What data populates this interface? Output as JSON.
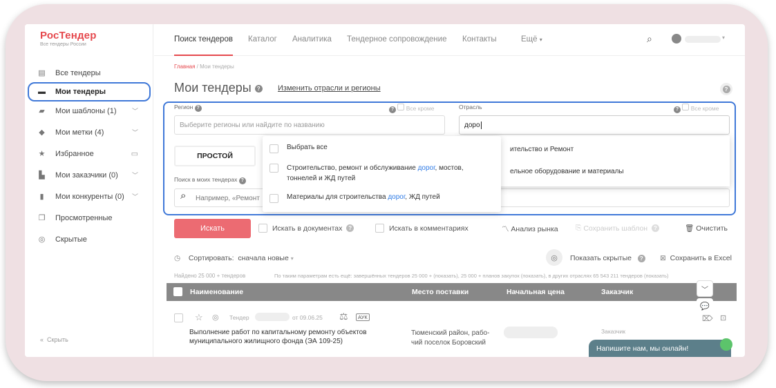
{
  "logo": {
    "title": "РосТендер",
    "subtitle": "Все тендеры России"
  },
  "sidebar": {
    "items": [
      {
        "label": "Все тендеры",
        "icon": "database-icon"
      },
      {
        "label": "Мои тендеры",
        "icon": "archive-icon"
      },
      {
        "label": "Мои шаблоны (1)",
        "icon": "folder-icon"
      },
      {
        "label": "Мои метки (4)",
        "icon": "tag-icon"
      },
      {
        "label": "Избранное",
        "icon": "star-icon"
      },
      {
        "label": "Мои заказчики (0)",
        "icon": "building-icon"
      },
      {
        "label": "Мои конкуренты (0)",
        "icon": "truck-icon"
      },
      {
        "label": "Просмотренные",
        "icon": "copy-icon"
      },
      {
        "label": "Скрытые",
        "icon": "eye-off-icon"
      }
    ],
    "collapse": "Скрыть"
  },
  "nav": {
    "tabs": [
      "Поиск тендеров",
      "Каталог",
      "Аналитика",
      "Тендерное сопровождение",
      "Контакты",
      "Ещё"
    ]
  },
  "breadcrumb": {
    "home": "Главная",
    "current": "Мои тендеры"
  },
  "page": {
    "title": "Мои тендеры",
    "link": "Изменить отрасли и регионы"
  },
  "filter": {
    "region_label": "Регион",
    "region_except": "Все кроме",
    "region_placeholder": "Выберите регионы или найдите по названию",
    "industry_label": "Отрасль",
    "industry_except": "Все кроме",
    "industry_value": "доро",
    "mode_simple": "ПРОСТОЙ",
    "search_label": "Поиск в моих тендерах",
    "search_placeholder": "Например, «Ремонт"
  },
  "dropdown": {
    "select_all": "Выбрать все",
    "item1_a": "Строительство, ремонт и обслуживание ",
    "item1_hl": "дорог",
    "item1_b": ", мостов,",
    "item1_c": "тоннелей и ЖД путей",
    "item2_a": "Материалы для строительства ",
    "item2_hl": "дорог",
    "item2_b": ", ЖД путей"
  },
  "dropdown_right": {
    "item1": "ительство и Ремонт",
    "item2": "ельное оборудование и материалы"
  },
  "actions": {
    "search": "Искать",
    "in_docs": "Искать в документах",
    "in_comments": "Искать в комментариях",
    "market": "Анализ рынка",
    "save_tpl": "Сохранить шаблон",
    "clear": "Очистить"
  },
  "sort": {
    "label": "Сортировать:",
    "value": "сначала новые",
    "show_hidden": "Показать скрытые",
    "excel": "Сохранить в Excel"
  },
  "found": {
    "left": "Найдено 25 000 + тендеров",
    "right": "По таким параметрам есть ещё: завершённых тендеров 25 000 + (показать), 25 000 + планов закупок (показать), в других отраслях 65 543 211 тендеров (показать)"
  },
  "table": {
    "headers": [
      "Наименование",
      "Место поставки",
      "Начальная цена",
      "Заказчик"
    ]
  },
  "row": {
    "type": "Тендер",
    "date": "от 09.06.25",
    "badge": "АУК",
    "title1": "Выполнение работ по капитальному ремонту объектов",
    "title2": "муниципального жилищного фонда (ЭА 109-25)",
    "place1": "Тюменский район, рабо-",
    "place2": "чий поселок Боровский",
    "customer": "Заказчик"
  },
  "chat": {
    "label": "Напишите нам, мы онлайн!"
  }
}
